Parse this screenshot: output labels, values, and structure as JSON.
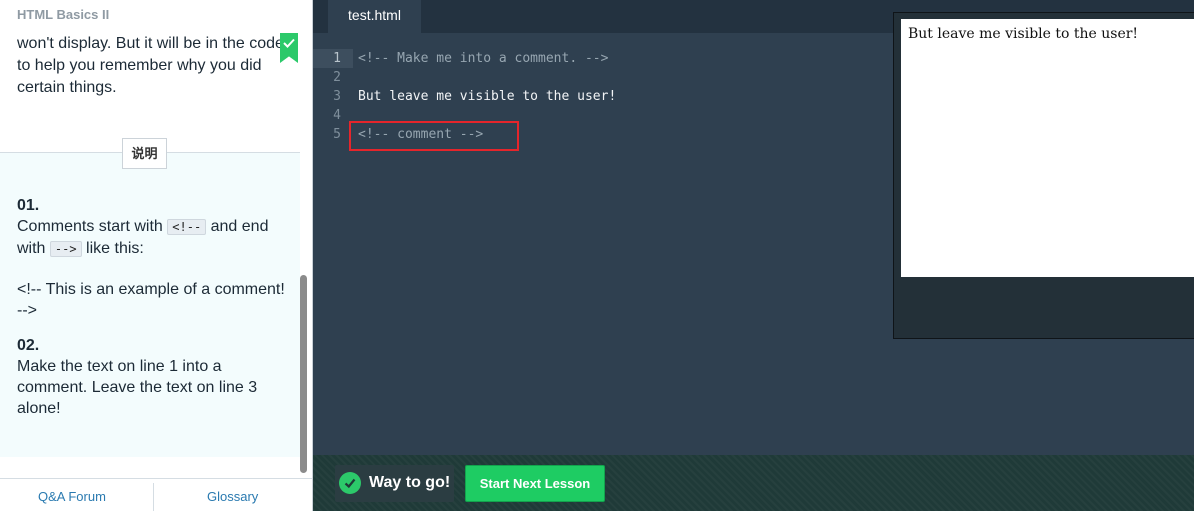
{
  "lesson": {
    "course_title": "HTML Basics II",
    "intro_lines": [
      "won't display. But it will be in the code",
      "to help you remember why you did",
      "certain things."
    ],
    "instructions_tab": "说明",
    "steps": [
      {
        "number": "01.",
        "text_a": "Comments start with",
        "code_a": "<!--",
        "text_b": "and end",
        "text_c": "with",
        "code_b": "-->",
        "text_d": "like this:",
        "example_line1": "<!-- This is an example of a comment!",
        "example_line2": "-->"
      },
      {
        "number": "02.",
        "line1": "Make the text on line 1 into a",
        "line2": "comment. Leave the text on line 3",
        "line3": "alone!"
      }
    ],
    "footer": {
      "qa": "Q&A Forum",
      "glossary": "Glossary"
    }
  },
  "editor": {
    "tab_name": "test.html",
    "lines": [
      {
        "number": "1",
        "text": "<!-- Make me into a comment. -->"
      },
      {
        "number": "2",
        "text": ""
      },
      {
        "number": "3",
        "text": "But leave me visible to the user!"
      },
      {
        "number": "4",
        "text": ""
      },
      {
        "number": "5",
        "text": "<!-- comment -->"
      }
    ]
  },
  "preview": {
    "text": "But leave me visible to the user!"
  },
  "bottom": {
    "success": "Way to go!",
    "next_button": "Start Next Lesson"
  },
  "colors": {
    "accent_green": "#1ecc63",
    "highlight_red": "#e5252b",
    "editor_bg": "#2f4050"
  },
  "icons": [
    "check-icon",
    "bookmark-check-icon"
  ]
}
